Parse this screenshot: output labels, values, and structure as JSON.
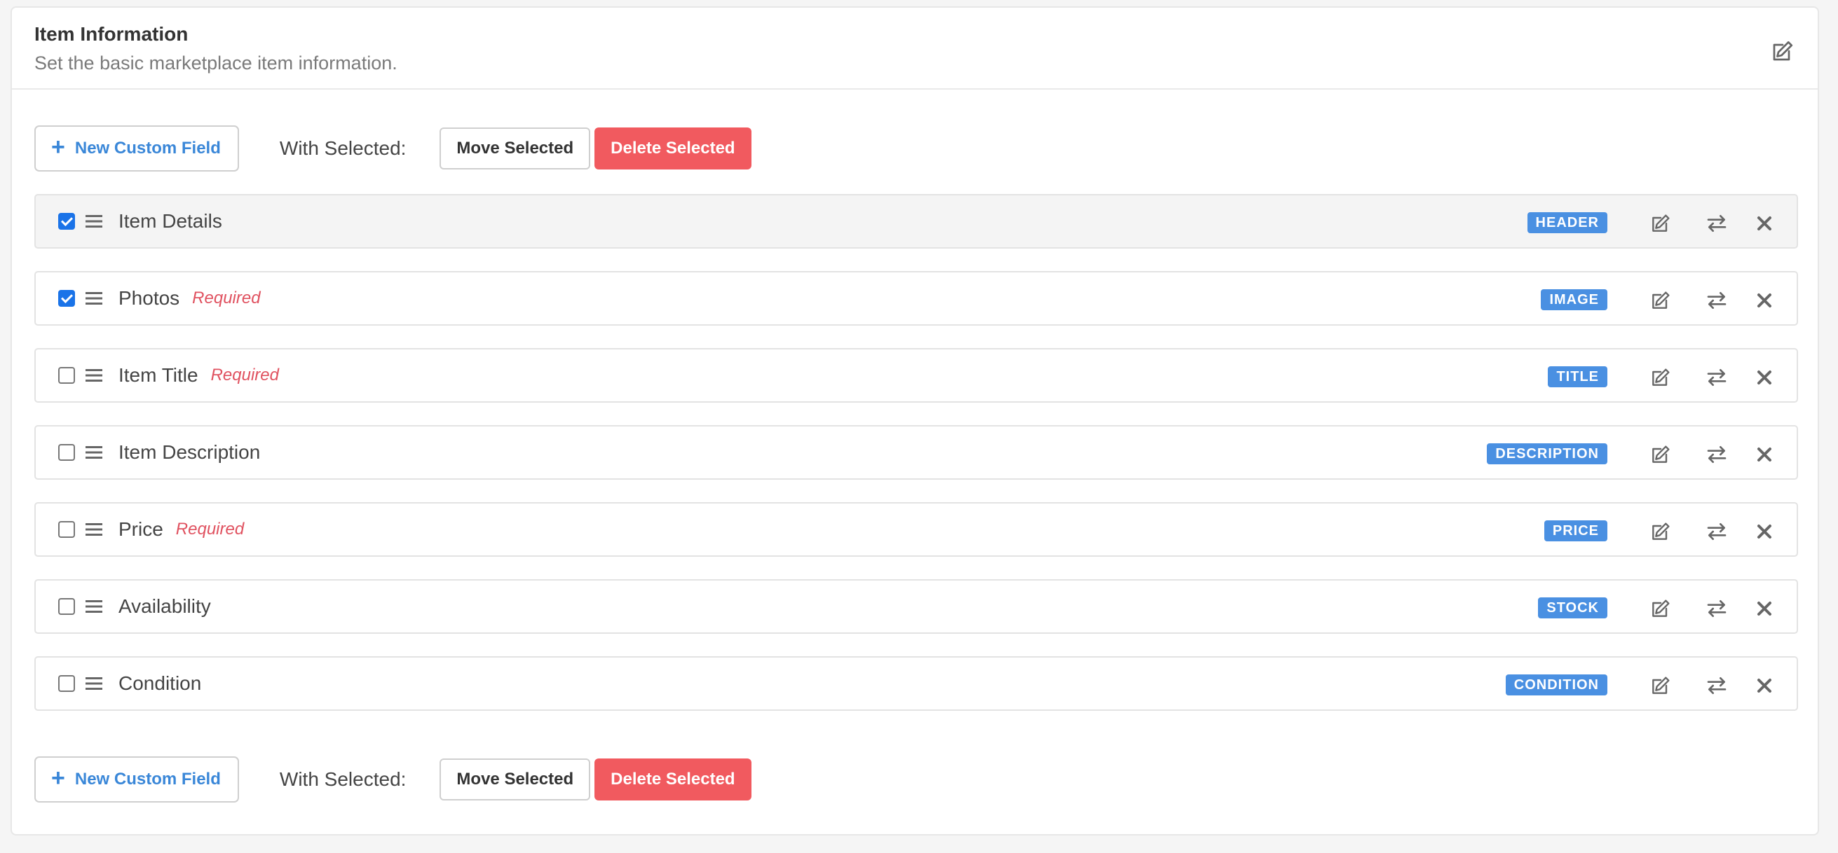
{
  "header": {
    "title": "Item Information",
    "subtitle": "Set the basic marketplace item information."
  },
  "toolbar": {
    "new_field_label": "New Custom Field",
    "with_selected_label": "With Selected:",
    "move_label": "Move Selected",
    "delete_label": "Delete Selected"
  },
  "fields": [
    {
      "name": "Item Details",
      "required": "",
      "type": "HEADER",
      "checked": true
    },
    {
      "name": "Photos",
      "required": "Required",
      "type": "IMAGE",
      "checked": true
    },
    {
      "name": "Item Title",
      "required": "Required",
      "type": "TITLE",
      "checked": false
    },
    {
      "name": "Item Description",
      "required": "",
      "type": "DESCRIPTION",
      "checked": false
    },
    {
      "name": "Price",
      "required": "Required",
      "type": "PRICE",
      "checked": false
    },
    {
      "name": "Availability",
      "required": "",
      "type": "STOCK",
      "checked": false
    },
    {
      "name": "Condition",
      "required": "",
      "type": "CONDITION",
      "checked": false
    }
  ],
  "colors": {
    "accent": "#3a87d8",
    "badge": "#4a90e2",
    "danger": "#f15a5f",
    "required": "#e05260",
    "checkbox": "#1a73e8"
  },
  "icons": {
    "edit": "edit-icon",
    "move": "move-arrows-icon",
    "delete": "close-icon",
    "drag": "drag-handle-icon",
    "add": "plus-icon"
  }
}
